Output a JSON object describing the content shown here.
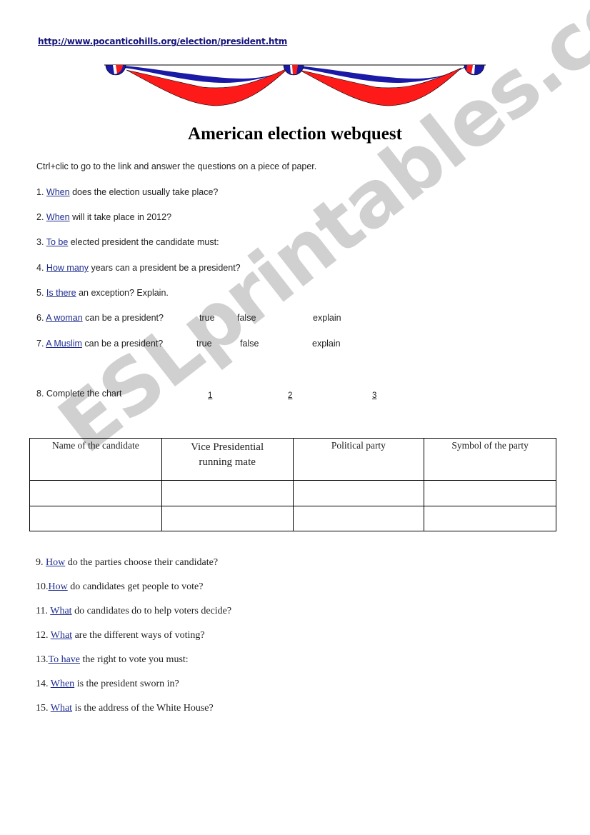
{
  "header": {
    "url": "http://www.pocanticohills.org/election/president.htm",
    "title": "American election webquest",
    "instruction": "Ctrl+clic to go to the link and answer the questions on a piece of paper."
  },
  "decoration": {
    "bunting": "red-white-blue-bunting",
    "colors": {
      "red": "#ff1a1a",
      "blue": "#1a1aa6",
      "white": "#ffffff"
    }
  },
  "questions_part1": [
    {
      "num": "1.",
      "link": "When",
      "rest": "does the election usually take place?"
    },
    {
      "num": "2.",
      "link": "When",
      "rest": "will it take place in 2012?"
    },
    {
      "num": "3.",
      "link": "To be",
      "rest": "elected president the candidate must:"
    },
    {
      "num": "4.",
      "link": "How many",
      "rest": "years can a president be a president?"
    },
    {
      "num": "5.",
      "link": "Is there",
      "rest": "an exception? Explain."
    },
    {
      "num": "6.",
      "link": "A woman",
      "rest": "can be a president?",
      "opt1": "true",
      "opt2": "false",
      "opt3": "explain"
    },
    {
      "num": "7.",
      "link": "A Muslim",
      "rest": "can be a president?",
      "opt1": "true",
      "opt2": "false",
      "opt3": "explain"
    }
  ],
  "chart_section": {
    "label": "8. Complete the chart",
    "links": [
      "1",
      "2",
      "3"
    ],
    "headers": [
      "Name of the candidate",
      "Vice Presidential running mate",
      "Political party",
      "Symbol of the party"
    ],
    "rows": [
      [
        "",
        "",
        "",
        ""
      ],
      [
        "",
        "",
        "",
        ""
      ]
    ]
  },
  "questions_part2": [
    {
      "num": "9.",
      "link": "How",
      "rest": "do the parties choose their candidate?"
    },
    {
      "num": "10.",
      "link": "How",
      "rest": "do candidates get people to vote?"
    },
    {
      "num": "11.",
      "link": "What",
      "rest": "do candidates do to help voters decide?"
    },
    {
      "num": "12.",
      "link": "What",
      "rest": "are the different ways of voting?"
    },
    {
      "num": "13.",
      "link": "To have",
      "rest": "the right to vote you must:"
    },
    {
      "num": "14.",
      "link": "When",
      "rest": "is the president sworn in?"
    },
    {
      "num": "15.",
      "link": "What",
      "rest": "is the address of the White House?"
    }
  ],
  "watermark": "ESLprintables.com"
}
